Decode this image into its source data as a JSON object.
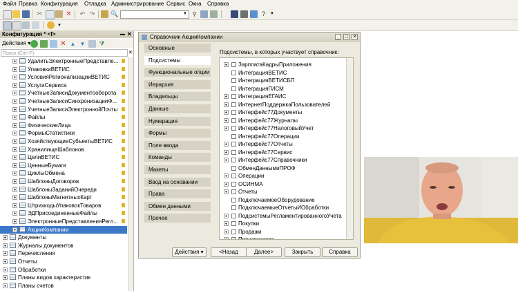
{
  "menu": [
    "Файл",
    "Правка",
    "Конфигурация",
    "Отладка",
    "Администрирование",
    "Сервис",
    "Окна",
    "Справка"
  ],
  "config_panel": {
    "title": "Конфигурация * <f>",
    "actions_label": "Действия ▾",
    "search_placeholder": "Поиск (Ctrl+F)",
    "tree": [
      {
        "label": "УдалитьЭлектронныеПредставле...",
        "level": 2,
        "lock": true
      },
      {
        "label": "УпаковкиВЕТИС",
        "level": 2,
        "lock": true
      },
      {
        "label": "УсловияРегионализацииВЕТИС",
        "level": 2,
        "lock": true
      },
      {
        "label": "УслугиСервиса",
        "level": 2,
        "lock": true
      },
      {
        "label": "УчетныеЗаписиДокументооборота",
        "level": 2,
        "lock": true
      },
      {
        "label": "УчетныеЗаписиСинхронизацииФ...",
        "level": 2,
        "lock": true
      },
      {
        "label": "УчетныеЗаписиЭлектроннойПочты",
        "level": 2,
        "lock": true
      },
      {
        "label": "Файлы",
        "level": 2,
        "lock": true
      },
      {
        "label": "ФизическиеЛица",
        "level": 2,
        "lock": true
      },
      {
        "label": "ФормыСтатистики",
        "level": 2,
        "lock": true
      },
      {
        "label": "ХозяйствующиеСубъектыВЕТИС",
        "level": 2,
        "lock": true
      },
      {
        "label": "ХранилищеШаблонов",
        "level": 2,
        "lock": true
      },
      {
        "label": "ЦелиВЕТИС",
        "level": 2,
        "lock": true
      },
      {
        "label": "ЦенныеБумаги",
        "level": 2,
        "lock": true
      },
      {
        "label": "ЦиклыОбмена",
        "level": 2,
        "lock": true
      },
      {
        "label": "ШаблоныДоговоров",
        "level": 2,
        "lock": true
      },
      {
        "label": "ШаблоныЗаданийОчереди",
        "level": 2,
        "lock": true
      },
      {
        "label": "ШаблоныМагнитныхКарт",
        "level": 2,
        "lock": true
      },
      {
        "label": "ШтрихкодыУпаковокТоваров",
        "level": 2,
        "lock": true
      },
      {
        "label": "ЭДПрисоединенныеФайлы",
        "level": 2,
        "lock": true
      },
      {
        "label": "ЭлектронныеПредставленияРегл...",
        "level": 2,
        "lock": true
      },
      {
        "label": "АкцииКомпании",
        "level": 2,
        "lock": false,
        "selected": true
      },
      {
        "label": "Документы",
        "level": 0,
        "lock": false
      },
      {
        "label": "Журналы документов",
        "level": 0,
        "lock": false
      },
      {
        "label": "Перечисления",
        "level": 0,
        "lock": false
      },
      {
        "label": "Отчеты",
        "level": 0,
        "lock": false
      },
      {
        "label": "Обработки",
        "level": 0,
        "lock": false
      },
      {
        "label": "Планы видов характеристик",
        "level": 0,
        "lock": false
      },
      {
        "label": "Планы счетов",
        "level": 0,
        "lock": false
      }
    ]
  },
  "dialog": {
    "title": "Справочник АкцииКомпании",
    "nav": [
      "Основные",
      "Подсистемы",
      "Функциональные опции",
      "Иерархия",
      "Владельцы",
      "Данные",
      "Нумерация",
      "Формы",
      "Поле ввода",
      "Команды",
      "Макеты",
      "Ввод на основании",
      "Права",
      "Обмен данными",
      "Прочее"
    ],
    "active_nav": 1,
    "subsystems_label": "Подсистемы, в которых участвует справочник:",
    "subsystems": [
      {
        "label": "ЗарплатаКадрыПриложения",
        "expand": true
      },
      {
        "label": "ИнтеграцияВЕТИС",
        "expand": false
      },
      {
        "label": "ИнтеграцияВЕТИСБП",
        "expand": false
      },
      {
        "label": "ИнтеграцияГИСМ",
        "expand": false
      },
      {
        "label": "ИнтеграцияЕГАИС",
        "expand": true
      },
      {
        "label": "ИнтернетПоддержкаПользователей",
        "expand": true
      },
      {
        "label": "Интерфейс77Документы",
        "expand": true
      },
      {
        "label": "Интерфейс77Журналы",
        "expand": true
      },
      {
        "label": "Интерфейс77НалоговыйУчет",
        "expand": true
      },
      {
        "label": "Интерфейс77Операции",
        "expand": false
      },
      {
        "label": "Интерфейс77Отчеты",
        "expand": true
      },
      {
        "label": "Интерфейс77Сервис",
        "expand": true
      },
      {
        "label": "Интерфейс77Справочники",
        "expand": true
      },
      {
        "label": "ОбменДаннымиПРОФ",
        "expand": false
      },
      {
        "label": "Операции",
        "expand": true
      },
      {
        "label": "ОСИНМА",
        "expand": true
      },
      {
        "label": "Отчеты",
        "expand": true
      },
      {
        "label": "ПодключаемоеОборудование",
        "expand": false
      },
      {
        "label": "ПодключаемыеОтчетыИОбработки",
        "expand": false
      },
      {
        "label": "ПодсистемыРегламентированногоУчета",
        "expand": true
      },
      {
        "label": "Покупки",
        "expand": true
      },
      {
        "label": "Продажи",
        "expand": true
      },
      {
        "label": "Производство",
        "expand": true
      }
    ],
    "buttons": {
      "actions": "Действия",
      "back": "<Назад",
      "next": "Далее>",
      "close": "Закрыть",
      "help": "Справка"
    }
  },
  "colors": {
    "selected_row": "#3c78c8",
    "nav_active": "#ffffff",
    "nav_bg": "#d6d3c4",
    "dialog_bg": "#eceade"
  }
}
